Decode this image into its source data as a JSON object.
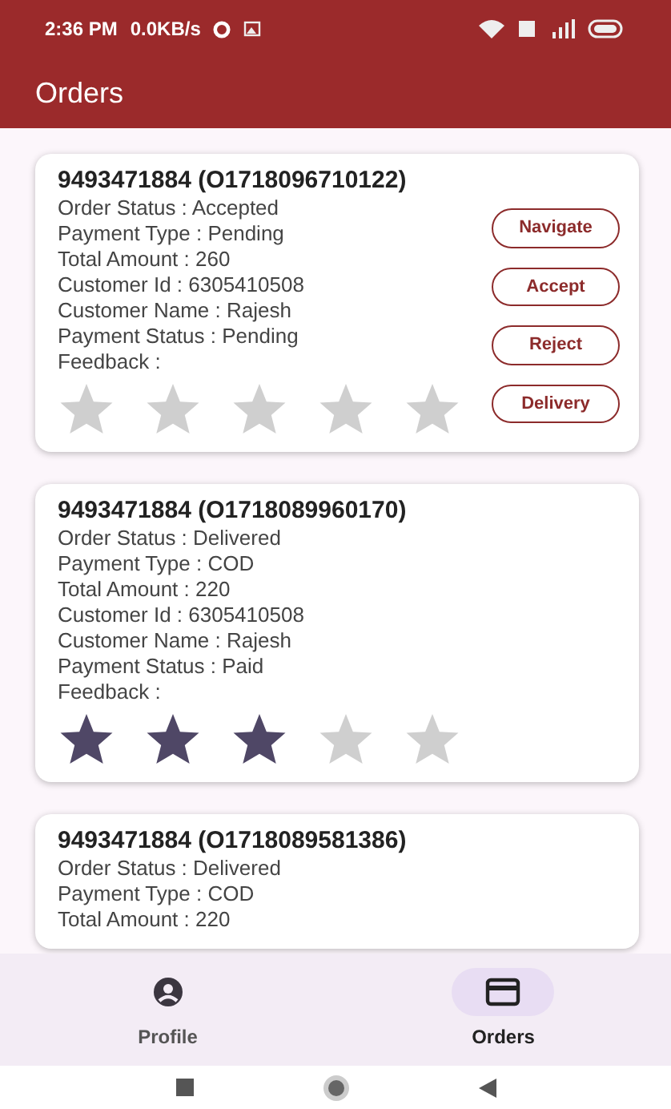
{
  "status_bar": {
    "time": "2:36 PM",
    "speed": "0.0KB/s"
  },
  "app_bar": {
    "title": "Orders"
  },
  "orders": [
    {
      "title": "9493471884 (O1718096710122)",
      "lines": [
        "Order Status : Accepted",
        "Payment Type : Pending",
        "Total Amount : 260",
        "Customer Id : 6305410508",
        "Customer Name : Rajesh",
        "Payment Status : Pending",
        "Feedback :"
      ],
      "stars": 0,
      "buttons": [
        "Navigate",
        "Accept",
        "Reject",
        "Delivery"
      ]
    },
    {
      "title": "9493471884 (O1718089960170)",
      "lines": [
        "Order Status : Delivered",
        "Payment Type : COD",
        "Total Amount : 220",
        "Customer Id : 6305410508",
        "Customer Name : Rajesh",
        "Payment Status : Paid",
        "Feedback :"
      ],
      "stars": 3
    },
    {
      "title": "9493471884 (O1718089581386)",
      "lines": [
        "Order Status : Delivered",
        "Payment Type : COD",
        "Total Amount : 220"
      ]
    }
  ],
  "bottom_nav": [
    {
      "label": "Profile",
      "selected": false
    },
    {
      "label": "Orders",
      "selected": true
    }
  ]
}
